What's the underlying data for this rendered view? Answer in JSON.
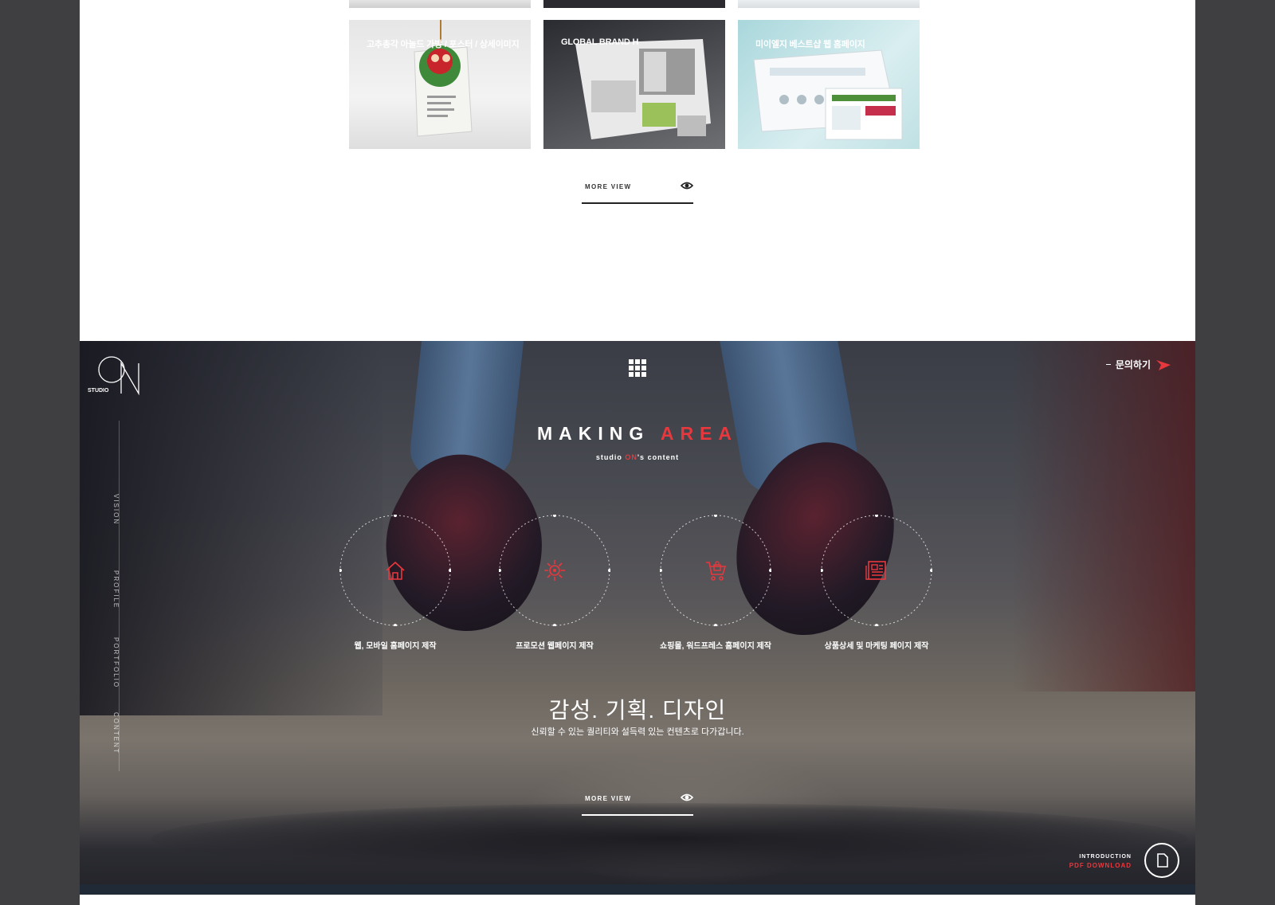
{
  "portfolio": {
    "items": [
      {
        "label": "고추총각 아놀드 가방 / 포스터 / 상세이미지"
      },
      {
        "label": "GLOBAL BRAND H"
      },
      {
        "label": "미이엘지 베스트샵 웹 홈페이지"
      }
    ],
    "more_view": "MORE VIEW"
  },
  "hero": {
    "logo_text": "STUDIO",
    "contact_label": "문의하기",
    "title_white": "MAKING",
    "title_red": "AREA",
    "subtitle_pre": "studio",
    "subtitle_red": "ON",
    "subtitle_post": "'s content",
    "nav": [
      "VISION",
      "PROFILE",
      "PORTFOLIO",
      "CONTENT"
    ],
    "services": [
      {
        "label": "웹, 모바일 홈페이지 제작",
        "icon": "home-icon"
      },
      {
        "label": "프로모션 웹페이지 제작",
        "icon": "sun-gear-icon"
      },
      {
        "label": "쇼핑몰, 워드프레스 홈페이지 제작",
        "icon": "cart-icon"
      },
      {
        "label": "상품상세 및 마케팅 페이지 제작",
        "icon": "newspaper-icon"
      }
    ],
    "slogan": "감성. 기획. 디자인",
    "description": "신뢰할 수 있는 퀄리티와 설득력 있는 컨텐츠로 다가갑니다.",
    "more_view": "MORE VIEW",
    "pdf_intro": "INTRODUCTION",
    "pdf_download": "PDF DOWNLOAD"
  },
  "colors": {
    "accent": "#e8383d",
    "frame_bg": "#3f3f41",
    "page_bg": "#ffffff"
  }
}
